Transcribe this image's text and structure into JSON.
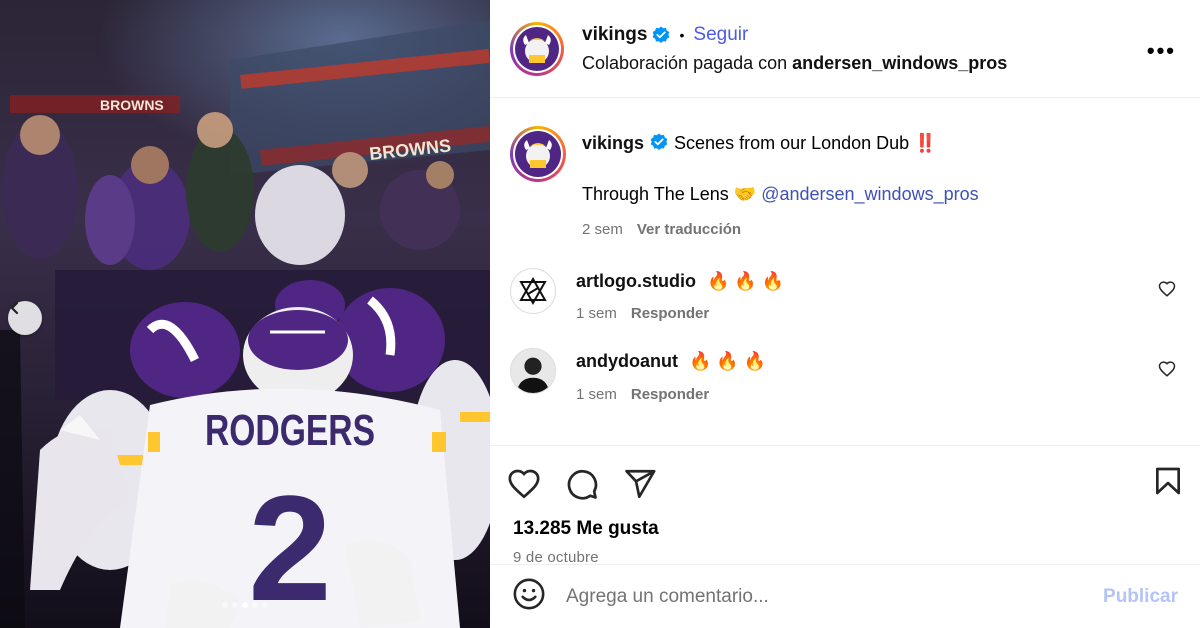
{
  "post": {
    "username": "vikings",
    "follow_label": "Seguir",
    "separator": "•",
    "sponsor_prefix": "Colaboración pagada con",
    "sponsor": "andersen_windows_pros",
    "more_label": "•••"
  },
  "caption": {
    "username": "vikings",
    "text": "Scenes from our London Dub ‼️",
    "line2_text": "Through The Lens 🤝",
    "mention": "@andersen_windows_pros",
    "time": "2 sem",
    "translate_label": "Ver traducción"
  },
  "comments": [
    {
      "username": "artlogo.studio",
      "text": "🔥 🔥 🔥",
      "time": "1 sem",
      "reply_label": "Responder"
    },
    {
      "username": "andydoanut",
      "text": "🔥 🔥 🔥",
      "time": "1 sem",
      "reply_label": "Responder"
    }
  ],
  "photo": {
    "jersey_name": "RODGERS",
    "jersey_number": "2",
    "banner_text": "BROWNS",
    "image_count": 5,
    "active_index": 3
  },
  "stats": {
    "likes": "13.285 Me gusta",
    "date": "9 de octubre"
  },
  "composer": {
    "placeholder": "Agrega un comentario...",
    "publish_label": "Publicar"
  },
  "colors": {
    "vikings_purple": "#4f2683",
    "vikings_gold": "#ffc62f",
    "link_blue": "#4a5be8",
    "publish_disabled": "#b3c4f7"
  },
  "icons": [
    "verified-badge-icon",
    "heart-icon",
    "comment-icon",
    "share-icon",
    "bookmark-icon",
    "emoji-icon",
    "chevron-left-icon",
    "more-icon"
  ]
}
